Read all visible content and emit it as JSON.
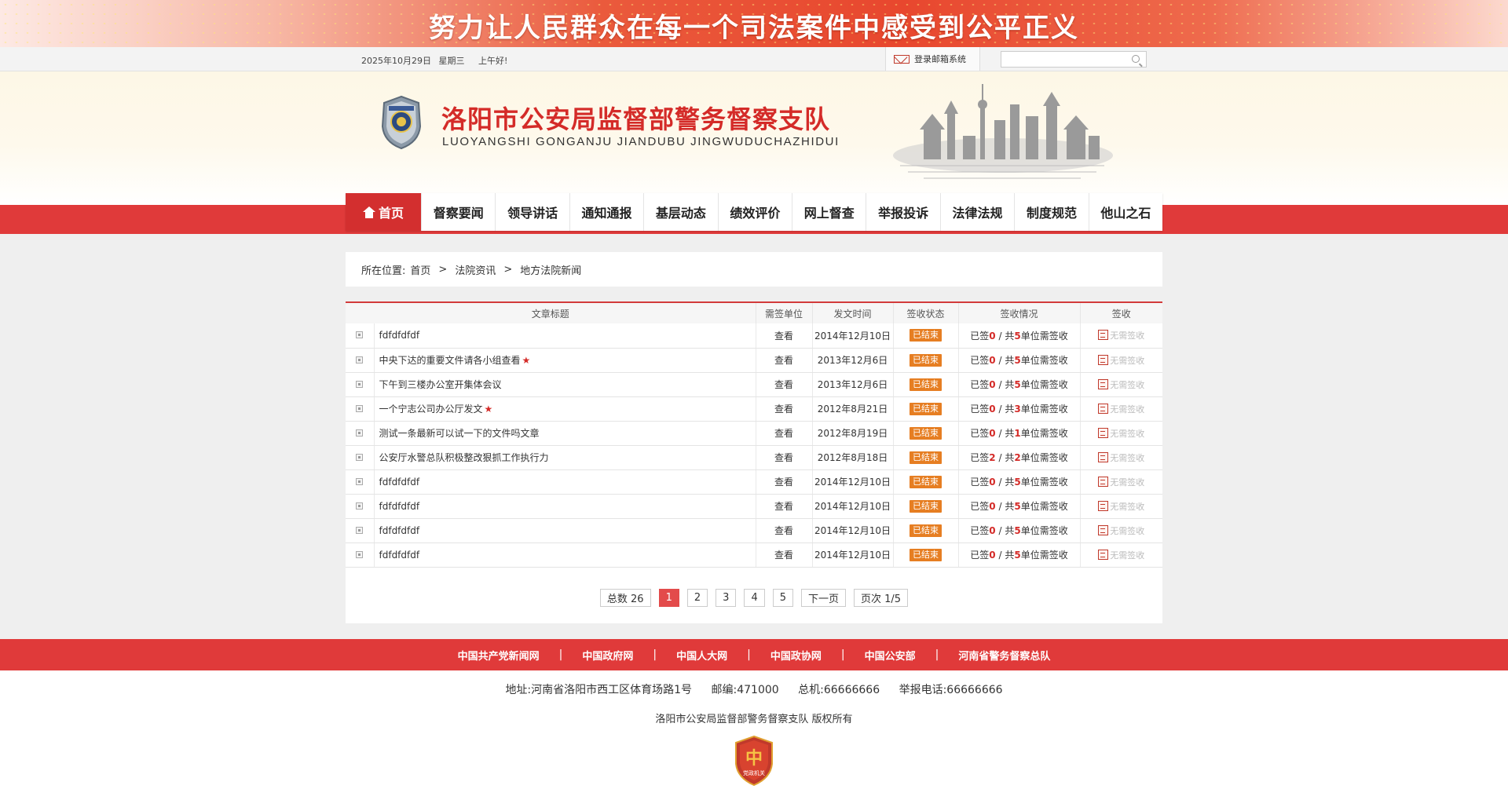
{
  "banner": {
    "slogan": "努力让人民群众在每一个司法案件中感受到公平正义"
  },
  "infobar": {
    "date": "2025年10月29日",
    "weekday": "星期三",
    "greeting": "上午好!",
    "mail_label": "登录邮箱系统",
    "search_placeholder": ""
  },
  "header": {
    "title": "洛阳市公安局监督部警务督察支队",
    "subtitle": "LUOYANGSHI GONGANJU JIANDUBU JINGWUDUCHAZHIDUI"
  },
  "nav": [
    {
      "label": "首页",
      "active": true
    },
    {
      "label": "督察要闻"
    },
    {
      "label": "领导讲话"
    },
    {
      "label": "通知通报"
    },
    {
      "label": "基层动态"
    },
    {
      "label": "绩效评价"
    },
    {
      "label": "网上督查"
    },
    {
      "label": "举报投诉"
    },
    {
      "label": "法律法规"
    },
    {
      "label": "制度规范"
    },
    {
      "label": "他山之石"
    }
  ],
  "breadcrumb": {
    "prefix": "所在位置:",
    "items": [
      "首页",
      "法院资讯",
      "地方法院新闻"
    ],
    "sep": ">"
  },
  "table": {
    "headers": [
      "文章标题",
      "需签单位",
      "发文时间",
      "签收状态",
      "签收情况",
      "签收"
    ],
    "rows": [
      {
        "title": "fdfdfdfdf",
        "star": false,
        "unit": "查看",
        "date": "2014年12月10日",
        "status": "已结束",
        "signed": "0",
        "total": "5",
        "sign": "无需签收"
      },
      {
        "title": "中央下达的重要文件请各小组查看",
        "star": true,
        "unit": "查看",
        "date": "2013年12月6日",
        "status": "已结束",
        "signed": "0",
        "total": "5",
        "sign": "无需签收"
      },
      {
        "title": "下午到三楼办公室开集体会议",
        "star": false,
        "unit": "查看",
        "date": "2013年12月6日",
        "status": "已结束",
        "signed": "0",
        "total": "5",
        "sign": "无需签收"
      },
      {
        "title": "一个宁志公司办公厅发文",
        "star": true,
        "unit": "查看",
        "date": "2012年8月21日",
        "status": "已结束",
        "signed": "0",
        "total": "3",
        "sign": "无需签收"
      },
      {
        "title": "测试一条最新可以试一下的文件吗文章",
        "star": false,
        "unit": "查看",
        "date": "2012年8月19日",
        "status": "已结束",
        "signed": "0",
        "total": "1",
        "sign": "无需签收"
      },
      {
        "title": "公安厅水警总队积极整改狠抓工作执行力",
        "star": false,
        "unit": "查看",
        "date": "2012年8月18日",
        "status": "已结束",
        "signed": "2",
        "total": "2",
        "sign": "无需签收"
      },
      {
        "title": "fdfdfdfdf",
        "star": false,
        "unit": "查看",
        "date": "2014年12月10日",
        "status": "已结束",
        "signed": "0",
        "total": "5",
        "sign": "无需签收"
      },
      {
        "title": "fdfdfdfdf",
        "star": false,
        "unit": "查看",
        "date": "2014年12月10日",
        "status": "已结束",
        "signed": "0",
        "total": "5",
        "sign": "无需签收"
      },
      {
        "title": "fdfdfdfdf",
        "star": false,
        "unit": "查看",
        "date": "2014年12月10日",
        "status": "已结束",
        "signed": "0",
        "total": "5",
        "sign": "无需签收"
      },
      {
        "title": "fdfdfdfdf",
        "star": false,
        "unit": "查看",
        "date": "2014年12月10日",
        "status": "已结束",
        "signed": "0",
        "total": "5",
        "sign": "无需签收"
      }
    ],
    "sign_prefix": "已签",
    "sign_mid": " / 共",
    "sign_suffix": "单位需签收"
  },
  "pager": {
    "total": "总数 26",
    "pages": [
      "1",
      "2",
      "3",
      "4",
      "5"
    ],
    "current": "1",
    "next": "下一页",
    "page_info": "页次 1/5"
  },
  "footer": {
    "links": [
      "中国共产党新闻网",
      "中国政府网",
      "中国人大网",
      "中国政协网",
      "中国公安部",
      "河南省警务督察总队"
    ],
    "address": "地址:河南省洛阳市西工区体育场路1号",
    "postcode": "邮编:471000",
    "switchboard": "总机:66666666",
    "report": "举报电话:66666666",
    "copyright": "洛阳市公安局监督部警务督察支队 版权所有",
    "badge_text": "党政机关"
  },
  "colors": {
    "brand_red": "#e03a3a",
    "title_red": "#d42b28",
    "status_orange": "#e67e22"
  }
}
